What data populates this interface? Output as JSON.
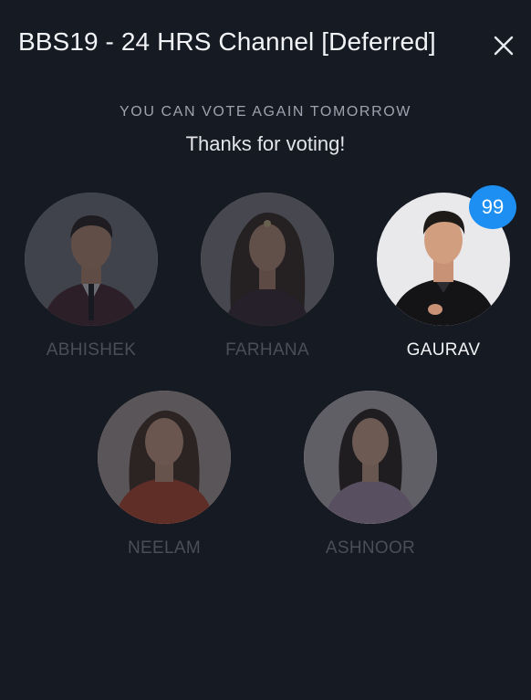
{
  "header": {
    "title": "BBS19 - 24 HRS Channel [Deferred]",
    "close_icon": "close-icon"
  },
  "status": {
    "notice": "YOU CAN VOTE AGAIN TOMORROW",
    "message": "Thanks for voting!"
  },
  "candidates": [
    {
      "name": "ABHISHEK",
      "selected": false,
      "outfit": "#4a2630",
      "hair": "#2a211d",
      "bg": "#7a7c83"
    },
    {
      "name": "FARHANA",
      "selected": false,
      "outfit": "#3b2a33",
      "hair": "#3b2a22",
      "bg": "#8a898e"
    },
    {
      "name": "GAURAV",
      "selected": true,
      "votes": "99",
      "outfit": "#141417",
      "hair": "#1e1a18",
      "bg": "#e9e9ec"
    },
    {
      "name": "NEELAM",
      "selected": false,
      "outfit": "#c24b2e",
      "hair": "#4a3024",
      "bg": "#b8a7a2"
    },
    {
      "name": "ASHNOOR",
      "selected": false,
      "outfit": "#b49ab8",
      "hair": "#2e2320",
      "bg": "#c9bfc4"
    }
  ],
  "colors": {
    "background": "#161a22",
    "accent": "#1d8ff2",
    "dim_name": "#4a4e59"
  }
}
